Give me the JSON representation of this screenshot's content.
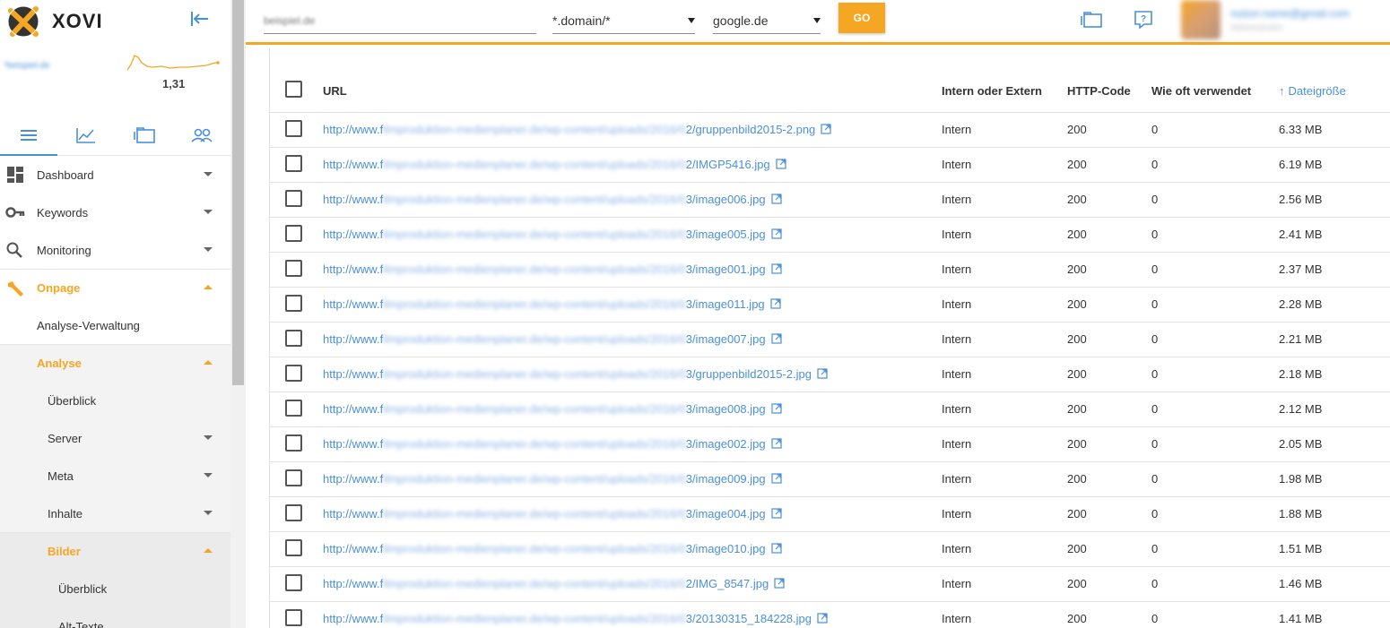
{
  "app": {
    "name": "XOVI"
  },
  "sidebar": {
    "visibility_label": "*beispiel.de",
    "visibility_value": "1,31",
    "menu": [
      {
        "label": "Dashboard",
        "icon": "dashboard-icon"
      },
      {
        "label": "Keywords",
        "icon": "key-icon"
      },
      {
        "label": "Monitoring",
        "icon": "search-icon"
      },
      {
        "label": "Onpage",
        "icon": "wrench-icon"
      },
      {
        "label": "Analyse-Verwaltung"
      },
      {
        "label": "Analyse"
      },
      {
        "label": "Überblick"
      },
      {
        "label": "Server"
      },
      {
        "label": "Meta"
      },
      {
        "label": "Inhalte"
      },
      {
        "label": "Bilder"
      },
      {
        "label": "Überblick"
      },
      {
        "label": "Alt-Texte"
      }
    ]
  },
  "topbar": {
    "domain_placeholder": "beispiel.de",
    "scope": "*.domain/*",
    "engine": "google.de",
    "go_label": "GO",
    "user_email": "nutzer.name@gmail.com",
    "user_sub": "Administrator"
  },
  "table": {
    "headers": {
      "url": "URL",
      "intern": "Intern oder Extern",
      "http": "HTTP-Code",
      "used": "Wie oft verwendet",
      "size": "Dateigröße"
    },
    "rows": [
      {
        "prefix": "http://www.f",
        "blur1": "ilmproduktion-medienplaner.de/wp-content/uploads/",
        "blur2": "2016/0",
        "suffix": "2/gruppenbild2015-2.png",
        "intern": "Intern",
        "http": "200",
        "used": "0",
        "size": "6.33 MB"
      },
      {
        "prefix": "http://www.f",
        "blur1": "ilmproduktion-medienplaner.de/wp-content/uploads/",
        "blur2": "2016/0",
        "suffix": "2/IMGP5416.jpg",
        "intern": "Intern",
        "http": "200",
        "used": "0",
        "size": "6.19 MB"
      },
      {
        "prefix": "http://www.f",
        "blur1": "ilmproduktion-medienplaner.de/wp-content/uploads/",
        "blur2": "2016/0",
        "suffix": "3/image006.jpg",
        "intern": "Intern",
        "http": "200",
        "used": "0",
        "size": "2.56 MB"
      },
      {
        "prefix": "http://www.f",
        "blur1": "ilmproduktion-medienplaner.de/wp-content/uploads/",
        "blur2": "2016/0",
        "suffix": "3/image005.jpg",
        "intern": "Intern",
        "http": "200",
        "used": "0",
        "size": "2.41 MB"
      },
      {
        "prefix": "http://www.f",
        "blur1": "ilmproduktion-medienplaner.de/wp-content/uploads/",
        "blur2": "2016/0",
        "suffix": "3/image001.jpg",
        "intern": "Intern",
        "http": "200",
        "used": "0",
        "size": "2.37 MB"
      },
      {
        "prefix": "http://www.f",
        "blur1": "ilmproduktion-medienplaner.de/wp-content/uploads/",
        "blur2": "2016/0",
        "suffix": "3/image011.jpg",
        "intern": "Intern",
        "http": "200",
        "used": "0",
        "size": "2.28 MB"
      },
      {
        "prefix": "http://www.f",
        "blur1": "ilmproduktion-medienplaner.de/wp-content/uploads/",
        "blur2": "2016/0",
        "suffix": "3/image007.jpg",
        "intern": "Intern",
        "http": "200",
        "used": "0",
        "size": "2.21 MB"
      },
      {
        "prefix": "http://www.f",
        "blur1": "ilmproduktion-medienplaner.de/wp-content/uploads/",
        "blur2": "2016/0",
        "suffix": "3/gruppenbild2015-2.jpg",
        "intern": "Intern",
        "http": "200",
        "used": "0",
        "size": "2.18 MB"
      },
      {
        "prefix": "http://www.f",
        "blur1": "ilmproduktion-medienplaner.de/wp-content/uploads/",
        "blur2": "2016/0",
        "suffix": "3/image008.jpg",
        "intern": "Intern",
        "http": "200",
        "used": "0",
        "size": "2.12 MB"
      },
      {
        "prefix": "http://www.f",
        "blur1": "ilmproduktion-medienplaner.de/wp-content/uploads/",
        "blur2": "2016/0",
        "suffix": "3/image002.jpg",
        "intern": "Intern",
        "http": "200",
        "used": "0",
        "size": "2.05 MB"
      },
      {
        "prefix": "http://www.f",
        "blur1": "ilmproduktion-medienplaner.de/wp-content/uploads/",
        "blur2": "2016/0",
        "suffix": "3/image009.jpg",
        "intern": "Intern",
        "http": "200",
        "used": "0",
        "size": "1.98 MB"
      },
      {
        "prefix": "http://www.f",
        "blur1": "ilmproduktion-medienplaner.de/wp-content/uploads/",
        "blur2": "2016/0",
        "suffix": "3/image004.jpg",
        "intern": "Intern",
        "http": "200",
        "used": "0",
        "size": "1.88 MB"
      },
      {
        "prefix": "http://www.f",
        "blur1": "ilmproduktion-medienplaner.de/wp-content/uploads/",
        "blur2": "2016/0",
        "suffix": "3/image010.jpg",
        "intern": "Intern",
        "http": "200",
        "used": "0",
        "size": "1.51 MB"
      },
      {
        "prefix": "http://www.f",
        "blur1": "ilmproduktion-medienplaner.de/wp-content/uploads/",
        "blur2": "2016/0",
        "suffix": "2/IMG_8547.jpg",
        "intern": "Intern",
        "http": "200",
        "used": "0",
        "size": "1.46 MB"
      },
      {
        "prefix": "http://www.f",
        "blur1": "ilmproduktion-medienplaner.de/wp-content/uploads/",
        "blur2": "2016/0",
        "suffix": "3/20130315_184228.jpg",
        "intern": "Intern",
        "http": "200",
        "used": "0",
        "size": "1.41 MB"
      }
    ]
  },
  "colors": {
    "accent": "#f5a623",
    "link": "#4a90d9"
  }
}
